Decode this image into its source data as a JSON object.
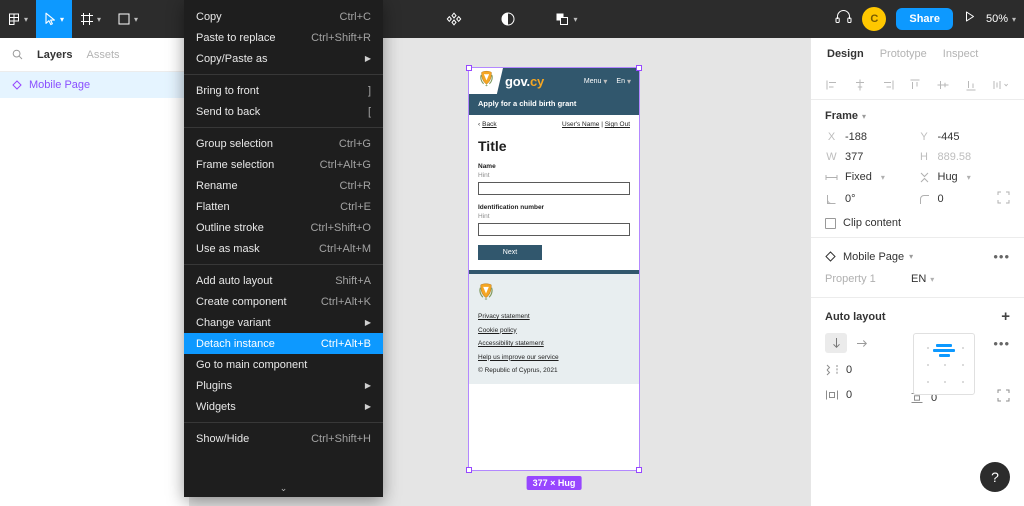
{
  "toolbar": {
    "menu_icon": "figma-menu-icon",
    "move_tool": "cursor-move-icon",
    "frame_tool": "frame-icon",
    "shape_tool": "square-icon",
    "components_icon": "components-icon",
    "mask_icon": "mask-contrast-icon",
    "boolean_icon": "boolean-union-icon",
    "headphones_icon": "headphones-icon",
    "avatar_initial": "C",
    "share_label": "Share",
    "present_icon": "play-icon",
    "zoom_label": "50%"
  },
  "sidebar": {
    "search_icon": "search-icon",
    "tabs": [
      {
        "label": "Layers",
        "active": true
      },
      {
        "label": "Assets",
        "active": false
      }
    ],
    "layers": [
      {
        "label": "Mobile Page",
        "icon": "component-diamond-icon",
        "selected": true
      }
    ]
  },
  "context_menu": {
    "groups": [
      [
        {
          "label": "Copy",
          "shortcut": "Ctrl+C"
        },
        {
          "label": "Paste to replace",
          "shortcut": "Ctrl+Shift+R"
        },
        {
          "label": "Copy/Paste as",
          "submenu": true
        }
      ],
      [
        {
          "label": "Bring to front",
          "shortcut": "]"
        },
        {
          "label": "Send to back",
          "shortcut": "["
        }
      ],
      [
        {
          "label": "Group selection",
          "shortcut": "Ctrl+G"
        },
        {
          "label": "Frame selection",
          "shortcut": "Ctrl+Alt+G"
        },
        {
          "label": "Rename",
          "shortcut": "Ctrl+R"
        },
        {
          "label": "Flatten",
          "shortcut": "Ctrl+E"
        },
        {
          "label": "Outline stroke",
          "shortcut": "Ctrl+Shift+O"
        },
        {
          "label": "Use as mask",
          "shortcut": "Ctrl+Alt+M"
        }
      ],
      [
        {
          "label": "Add auto layout",
          "shortcut": "Shift+A"
        },
        {
          "label": "Create component",
          "shortcut": "Ctrl+Alt+K"
        },
        {
          "label": "Change variant",
          "submenu": true
        },
        {
          "label": "Detach instance",
          "shortcut": "Ctrl+Alt+B",
          "highlighted": true
        },
        {
          "label": "Go to main component",
          "shortcut": ""
        },
        {
          "label": "Plugins",
          "submenu": true
        },
        {
          "label": "Widgets",
          "submenu": true
        }
      ],
      [
        {
          "label": "Show/Hide",
          "shortcut": "Ctrl+Shift+H"
        }
      ]
    ],
    "more_icon": "chevron-down-icon"
  },
  "canvas": {
    "selection_badge": "377 × Hug",
    "mobile_page": {
      "brand_primary": "gov.",
      "brand_accent": "cy",
      "logo_icon": "cyprus-coat-of-arms-icon",
      "nav": [
        {
          "label": "Menu"
        },
        {
          "label": "En"
        }
      ],
      "subtitle": "Apply for a child birth grant",
      "back_label": "Back",
      "back_icon": "chevron-left-icon",
      "user_label": "User's Name",
      "separator": "|",
      "sign_out_label": "Sign Out",
      "title": "Title",
      "fields": [
        {
          "label": "Name",
          "hint": "Hint",
          "value": ""
        },
        {
          "label": "Identification number",
          "hint": "Hint",
          "value": ""
        }
      ],
      "next_label": "Next",
      "footer": {
        "logo_icon": "cyprus-coat-of-arms-icon",
        "links": [
          "Privacy statement",
          "Cookie policy",
          "Accessibility statement",
          "Help us improve our service"
        ],
        "copyright": "© Republic of Cyprus, 2021"
      }
    }
  },
  "right_panel": {
    "tabs": [
      {
        "label": "Design",
        "active": true
      },
      {
        "label": "Prototype",
        "active": false
      },
      {
        "label": "Inspect",
        "active": false
      }
    ],
    "align_icons": [
      "align-left-icon",
      "align-horizontal-center-icon",
      "align-right-icon",
      "align-top-icon",
      "align-vertical-center-icon",
      "align-bottom-icon",
      "distribute-icon"
    ],
    "frame": {
      "title": "Frame",
      "x_label": "X",
      "x_value": "-188",
      "y_label": "Y",
      "y_value": "-445",
      "w_label": "W",
      "w_value": "377",
      "h_label": "H",
      "h_value": "889.58",
      "width_resizing": "Fixed",
      "height_resizing": "Hug",
      "rotation": "0°",
      "corner_radius": "0",
      "independent_corners_icon": "independent-corners-icon",
      "clip_content_label": "Clip content",
      "clip_content_checked": false
    },
    "component": {
      "name": "Mobile Page",
      "icon": "component-diamond-icon",
      "more_icon": "more-options-icon",
      "property_name": "Property 1",
      "property_value": "EN"
    },
    "auto_layout": {
      "title": "Auto layout",
      "add_icon": "plus-icon",
      "direction_vertical_icon": "arrow-down-icon",
      "direction_horizontal_icon": "arrow-right-icon",
      "direction_active": "vertical",
      "gap_value": "0",
      "horizontal_padding": "0",
      "vertical_padding": "0",
      "more_icon": "more-options-icon",
      "advanced_icon": "advanced-layout-icon"
    },
    "help_label": "?"
  },
  "colors": {
    "accent_blue": "#0d99ff",
    "selection_purple": "#9747ff",
    "gov_navy": "#31576d",
    "gov_orange": "#f5a623",
    "avatar_yellow": "#ffc700"
  }
}
